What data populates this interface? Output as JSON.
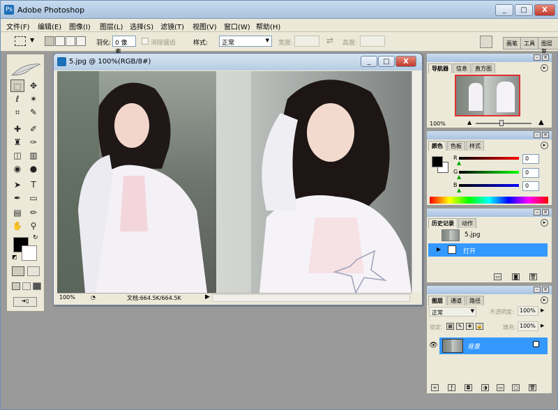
{
  "app": {
    "title": "Adobe Photoshop",
    "logo_letter": "Ps"
  },
  "window_controls": {
    "minimize": "_",
    "maximize": "□",
    "close": "X"
  },
  "menu": [
    "文件(F)",
    "编辑(E)",
    "图像(I)",
    "图层(L)",
    "选择(S)",
    "滤镜(T)",
    "视图(V)",
    "窗口(W)",
    "帮助(H)"
  ],
  "options": {
    "feather_label": "羽化:",
    "feather_value": "0 像素",
    "antialias_label": "消除锯齿",
    "style_label": "样式:",
    "style_value": "正常",
    "width_label": "宽度:",
    "height_label": "高度:",
    "swap_glyph": "⇄",
    "palette_tabs": [
      "画笔",
      "工具",
      "图层复"
    ]
  },
  "document": {
    "title": "5.jpg @ 100%(RGB/8#)",
    "zoom": "100%",
    "doc_size": "文档:664.5K/664.5K"
  },
  "navigator": {
    "tabs": [
      "导航器",
      "信息",
      "直方图"
    ],
    "zoom": "100%"
  },
  "color": {
    "tabs": [
      "颜色",
      "色板",
      "样式"
    ],
    "r_label": "R",
    "g_label": "G",
    "b_label": "B",
    "r_value": "0",
    "g_value": "0",
    "b_value": "0",
    "r_fraction": 0,
    "g_fraction": 0,
    "b_fraction": 0
  },
  "history": {
    "tabs": [
      "历史记录",
      "动作"
    ],
    "snapshot_label": "5.jpg",
    "step_label": "打开"
  },
  "layers": {
    "tabs": [
      "图层",
      "通道",
      "路径"
    ],
    "blend_mode": "正常",
    "opacity_label": "不透明度:",
    "opacity_value": "100%",
    "lock_label": "锁定:",
    "fill_label": "填充:",
    "fill_value": "100%",
    "layer_name": "背景"
  },
  "colors": {
    "selection_blue": "#3399ff",
    "panel_bg": "#ece9d8",
    "workspace_gray": "#9a9a9a"
  }
}
